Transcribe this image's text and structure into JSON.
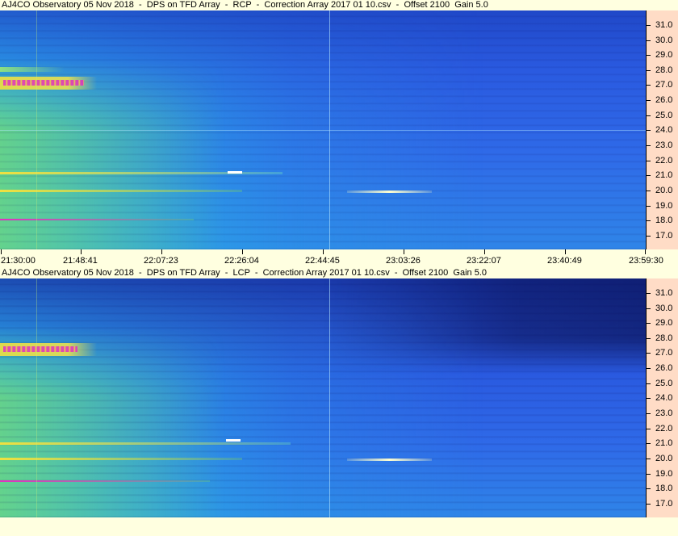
{
  "panels": [
    {
      "id": "rcp",
      "title": "AJ4CO Observatory 05 Nov 2018  -  DPS on TFD Array  -  RCP  -  Correction Array 2017 01 10.csv  -  Offset 2100  Gain 5.0",
      "freq_labels": [
        "31.0",
        "30.0",
        "29.0",
        "28.0",
        "27.0",
        "26.0",
        "25.0",
        "24.0",
        "23.0",
        "22.0",
        "21.0",
        "20.0",
        "19.0",
        "18.0",
        "17.0"
      ]
    },
    {
      "id": "lcp",
      "title": "AJ4CO Observatory 05 Nov 2018  -  DPS on TFD Array  -  LCP  -  Correction Array 2017 01 10.csv  -  Offset 2100  Gain 5.0",
      "freq_labels": [
        "31.0",
        "30.0",
        "29.0",
        "28.0",
        "27.0",
        "26.0",
        "25.0",
        "24.0",
        "23.0",
        "22.0",
        "21.0",
        "20.0",
        "19.0",
        "18.0",
        "17.0"
      ]
    }
  ],
  "time_labels": [
    "21:30:00",
    "21:48:41",
    "22:07:23",
    "22:26:04",
    "22:44:45",
    "23:03:26",
    "23:22:07",
    "23:40:49",
    "23:59:30"
  ],
  "colors": {
    "background": "#ffffe0",
    "axis_bg": "#ffdcc6",
    "spectrogram_base": "#2a5ae0",
    "spectrogram_dark": "#1a2f9a",
    "cyan": "#25c8e8",
    "green": "#7ce06a",
    "yellow": "#f0e040",
    "magenta": "#e030c0"
  }
}
